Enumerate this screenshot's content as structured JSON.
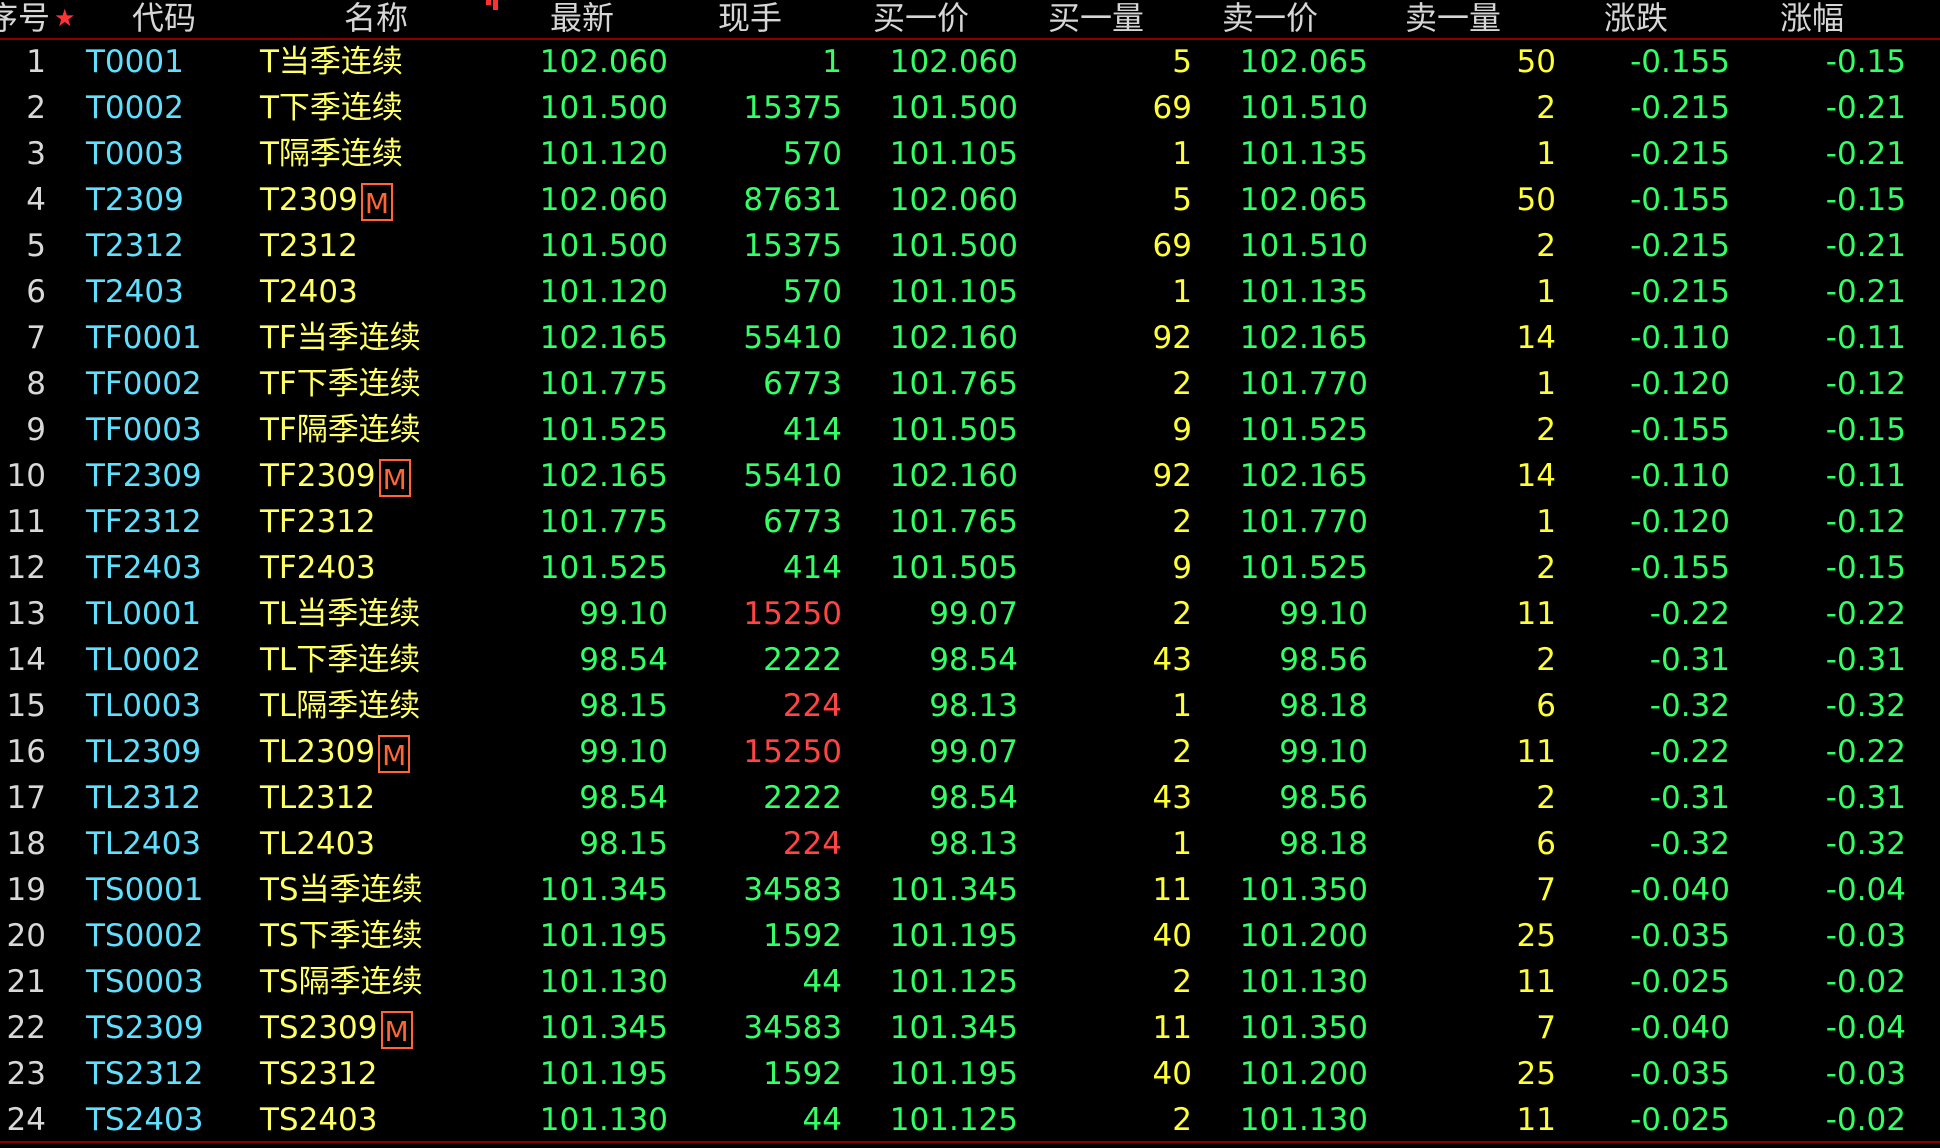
{
  "header": {
    "seq": "序号",
    "code": "代码",
    "name": "名称",
    "last": "最新",
    "volume": "现手",
    "bid_price": "买一价",
    "bid_qty": "买一量",
    "ask_price": "卖一价",
    "ask_qty": "卖一量",
    "change": "涨跌",
    "change_pct": "涨幅"
  },
  "colors": {
    "background": "#000000",
    "code": "#5fe0ff",
    "name": "#ffff66",
    "down": "#33ff66",
    "up": "#ff4444",
    "qty": "#ffff33",
    "badge": "#ff6633",
    "divider": "#8a0000"
  },
  "icons": {
    "favorite": "star-icon",
    "sort_indicator": "sort-dots-icon",
    "main_contract": "main-contract-badge"
  },
  "rows": [
    {
      "seq": "1",
      "code": "T0001",
      "name": "T当季连续",
      "badge": "",
      "last": "102.060",
      "vol": "1",
      "vol_up": false,
      "bid": "102.060",
      "bidq": "5",
      "ask": "102.065",
      "askq": "50",
      "chg": "-0.155",
      "pct": "-0.15"
    },
    {
      "seq": "2",
      "code": "T0002",
      "name": "T下季连续",
      "badge": "",
      "last": "101.500",
      "vol": "15375",
      "vol_up": false,
      "bid": "101.500",
      "bidq": "69",
      "ask": "101.510",
      "askq": "2",
      "chg": "-0.215",
      "pct": "-0.21"
    },
    {
      "seq": "3",
      "code": "T0003",
      "name": "T隔季连续",
      "badge": "",
      "last": "101.120",
      "vol": "570",
      "vol_up": false,
      "bid": "101.105",
      "bidq": "1",
      "ask": "101.135",
      "askq": "1",
      "chg": "-0.215",
      "pct": "-0.21"
    },
    {
      "seq": "4",
      "code": "T2309",
      "name": "T2309",
      "badge": "M",
      "last": "102.060",
      "vol": "87631",
      "vol_up": false,
      "bid": "102.060",
      "bidq": "5",
      "ask": "102.065",
      "askq": "50",
      "chg": "-0.155",
      "pct": "-0.15"
    },
    {
      "seq": "5",
      "code": "T2312",
      "name": "T2312",
      "badge": "",
      "last": "101.500",
      "vol": "15375",
      "vol_up": false,
      "bid": "101.500",
      "bidq": "69",
      "ask": "101.510",
      "askq": "2",
      "chg": "-0.215",
      "pct": "-0.21"
    },
    {
      "seq": "6",
      "code": "T2403",
      "name": "T2403",
      "badge": "",
      "last": "101.120",
      "vol": "570",
      "vol_up": false,
      "bid": "101.105",
      "bidq": "1",
      "ask": "101.135",
      "askq": "1",
      "chg": "-0.215",
      "pct": "-0.21"
    },
    {
      "seq": "7",
      "code": "TF0001",
      "name": "TF当季连续",
      "badge": "",
      "last": "102.165",
      "vol": "55410",
      "vol_up": false,
      "bid": "102.160",
      "bidq": "92",
      "ask": "102.165",
      "askq": "14",
      "chg": "-0.110",
      "pct": "-0.11"
    },
    {
      "seq": "8",
      "code": "TF0002",
      "name": "TF下季连续",
      "badge": "",
      "last": "101.775",
      "vol": "6773",
      "vol_up": false,
      "bid": "101.765",
      "bidq": "2",
      "ask": "101.770",
      "askq": "1",
      "chg": "-0.120",
      "pct": "-0.12"
    },
    {
      "seq": "9",
      "code": "TF0003",
      "name": "TF隔季连续",
      "badge": "",
      "last": "101.525",
      "vol": "414",
      "vol_up": false,
      "bid": "101.505",
      "bidq": "9",
      "ask": "101.525",
      "askq": "2",
      "chg": "-0.155",
      "pct": "-0.15"
    },
    {
      "seq": "10",
      "code": "TF2309",
      "name": "TF2309",
      "badge": "M",
      "last": "102.165",
      "vol": "55410",
      "vol_up": false,
      "bid": "102.160",
      "bidq": "92",
      "ask": "102.165",
      "askq": "14",
      "chg": "-0.110",
      "pct": "-0.11"
    },
    {
      "seq": "11",
      "code": "TF2312",
      "name": "TF2312",
      "badge": "",
      "last": "101.775",
      "vol": "6773",
      "vol_up": false,
      "bid": "101.765",
      "bidq": "2",
      "ask": "101.770",
      "askq": "1",
      "chg": "-0.120",
      "pct": "-0.12"
    },
    {
      "seq": "12",
      "code": "TF2403",
      "name": "TF2403",
      "badge": "",
      "last": "101.525",
      "vol": "414",
      "vol_up": false,
      "bid": "101.505",
      "bidq": "9",
      "ask": "101.525",
      "askq": "2",
      "chg": "-0.155",
      "pct": "-0.15"
    },
    {
      "seq": "13",
      "code": "TL0001",
      "name": "TL当季连续",
      "badge": "",
      "last": "99.10",
      "vol": "15250",
      "vol_up": true,
      "bid": "99.07",
      "bidq": "2",
      "ask": "99.10",
      "askq": "11",
      "chg": "-0.22",
      "pct": "-0.22"
    },
    {
      "seq": "14",
      "code": "TL0002",
      "name": "TL下季连续",
      "badge": "",
      "last": "98.54",
      "vol": "2222",
      "vol_up": false,
      "bid": "98.54",
      "bidq": "43",
      "ask": "98.56",
      "askq": "2",
      "chg": "-0.31",
      "pct": "-0.31"
    },
    {
      "seq": "15",
      "code": "TL0003",
      "name": "TL隔季连续",
      "badge": "",
      "last": "98.15",
      "vol": "224",
      "vol_up": true,
      "bid": "98.13",
      "bidq": "1",
      "ask": "98.18",
      "askq": "6",
      "chg": "-0.32",
      "pct": "-0.32"
    },
    {
      "seq": "16",
      "code": "TL2309",
      "name": "TL2309",
      "badge": "M",
      "last": "99.10",
      "vol": "15250",
      "vol_up": true,
      "bid": "99.07",
      "bidq": "2",
      "ask": "99.10",
      "askq": "11",
      "chg": "-0.22",
      "pct": "-0.22"
    },
    {
      "seq": "17",
      "code": "TL2312",
      "name": "TL2312",
      "badge": "",
      "last": "98.54",
      "vol": "2222",
      "vol_up": false,
      "bid": "98.54",
      "bidq": "43",
      "ask": "98.56",
      "askq": "2",
      "chg": "-0.31",
      "pct": "-0.31"
    },
    {
      "seq": "18",
      "code": "TL2403",
      "name": "TL2403",
      "badge": "",
      "last": "98.15",
      "vol": "224",
      "vol_up": true,
      "bid": "98.13",
      "bidq": "1",
      "ask": "98.18",
      "askq": "6",
      "chg": "-0.32",
      "pct": "-0.32"
    },
    {
      "seq": "19",
      "code": "TS0001",
      "name": "TS当季连续",
      "badge": "",
      "last": "101.345",
      "vol": "34583",
      "vol_up": false,
      "bid": "101.345",
      "bidq": "11",
      "ask": "101.350",
      "askq": "7",
      "chg": "-0.040",
      "pct": "-0.04"
    },
    {
      "seq": "20",
      "code": "TS0002",
      "name": "TS下季连续",
      "badge": "",
      "last": "101.195",
      "vol": "1592",
      "vol_up": false,
      "bid": "101.195",
      "bidq": "40",
      "ask": "101.200",
      "askq": "25",
      "chg": "-0.035",
      "pct": "-0.03"
    },
    {
      "seq": "21",
      "code": "TS0003",
      "name": "TS隔季连续",
      "badge": "",
      "last": "101.130",
      "vol": "44",
      "vol_up": false,
      "bid": "101.125",
      "bidq": "2",
      "ask": "101.130",
      "askq": "11",
      "chg": "-0.025",
      "pct": "-0.02"
    },
    {
      "seq": "22",
      "code": "TS2309",
      "name": "TS2309",
      "badge": "M",
      "last": "101.345",
      "vol": "34583",
      "vol_up": false,
      "bid": "101.345",
      "bidq": "11",
      "ask": "101.350",
      "askq": "7",
      "chg": "-0.040",
      "pct": "-0.04"
    },
    {
      "seq": "23",
      "code": "TS2312",
      "name": "TS2312",
      "badge": "",
      "last": "101.195",
      "vol": "1592",
      "vol_up": false,
      "bid": "101.195",
      "bidq": "40",
      "ask": "101.200",
      "askq": "25",
      "chg": "-0.035",
      "pct": "-0.03"
    },
    {
      "seq": "24",
      "code": "TS2403",
      "name": "TS2403",
      "badge": "",
      "last": "101.130",
      "vol": "44",
      "vol_up": false,
      "bid": "101.125",
      "bidq": "2",
      "ask": "101.130",
      "askq": "11",
      "chg": "-0.025",
      "pct": "-0.02"
    }
  ]
}
